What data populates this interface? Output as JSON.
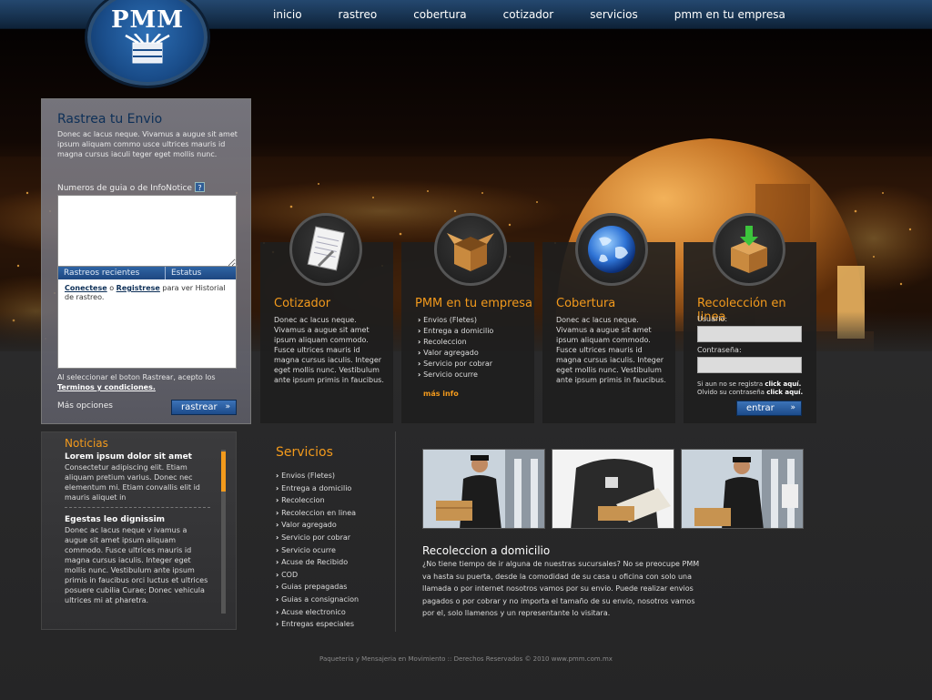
{
  "brand": {
    "logo_text": "PMM"
  },
  "nav": {
    "items": [
      "inicio",
      "rastreo",
      "cobertura",
      "cotizador",
      "servicios",
      "pmm en tu empresa"
    ]
  },
  "tracking": {
    "title": "Rastrea tu Envio",
    "description": "Donec ac lacus neque. Vivamus a augue sit amet ipsum aliquam commo usce ultrices mauris id magna cursus iaculi teger eget mollis nunc.",
    "guide_label": "Numeros de guia o de InfoNotice",
    "guide_help": "?",
    "recent_col1": "Rastreos recientes",
    "recent_col2": "Estatus",
    "recent_link1": "Conectese",
    "recent_conj": " o ",
    "recent_link2": "Registrese",
    "recent_rest": " para ver Historial de rastreo.",
    "select_note": "Al seleccionar el boton Rastrear, acepto los ",
    "terms_link": "Terminos y condiciones.",
    "more_options": "Más opciones",
    "button": "rastrear",
    "button_arrow": "»"
  },
  "news": {
    "title": "Noticias",
    "items": [
      {
        "head": "Lorem ipsum dolor sit amet",
        "body": "Consectetur adipiscing elit. Etiam aliquam pretium varius. Donec nec elementum mi. Etiam convallis elit id mauris aliquet in"
      },
      {
        "head": "Egestas leo dignissim",
        "body": "Donec ac lacus neque v ivamus a augue sit amet ipsum aliquam commodo. Fusce ultrices mauris id magna cursus iaculis. Integer eget mollis nunc. Vestibulum ante ipsum primis in faucibus orci luctus et ultrices posuere cubilia Curae; Donec vehicula ultrices mi at pharetra."
      }
    ]
  },
  "cards": {
    "cotizador": {
      "title": "Cotizador",
      "text": "Donec ac lacus neque. Vivamus a augue sit amet ipsum aliquam commodo. Fusce ultrices mauris id magna cursus iaculis. Integer eget mollis nunc. Vestibulum ante ipsum primis in faucibus."
    },
    "empresa": {
      "title": "PMM en tu empresa",
      "items": [
        "Envios (Fletes)",
        "Entrega a domicilio",
        "Recoleccion",
        "Valor agregado",
        "Servicio por cobrar",
        "Servicio ocurre"
      ],
      "more": "más info"
    },
    "cobertura": {
      "title": "Cobertura",
      "text": "Donec ac lacus neque. Vivamus a augue sit amet ipsum aliquam commodo. Fusce ultrices mauris id magna cursus iaculis. Integer eget mollis nunc. Vestibulum ante ipsum primis in faucibus."
    },
    "recoleccion": {
      "title": "Recolección en linea",
      "user_label": "Usuario:",
      "pass_label": "Contraseña:",
      "note_register": "Si aun no se registra ",
      "note_click1": "click aquí.",
      "note_forgot": "Olvido su contraseña ",
      "note_click2": "click aquí.",
      "button": "entrar",
      "button_arrow": "»"
    }
  },
  "services": {
    "title": "Servicios",
    "items": [
      "Envios (Fletes)",
      "Entrega a domicilio",
      "Recoleccion",
      "Recoleccion en linea",
      "Valor agregado",
      "Servicio por cobrar",
      "Servicio ocurre",
      "Acuse de Recibido",
      "COD",
      "Guias prepagadas",
      "Guias a consignacion",
      "Acuse electronico",
      "Entregas especiales"
    ]
  },
  "home": {
    "title": "Recoleccion a domicilio",
    "text": "¿No tiene tiempo de ir alguna de nuestras sucursales? No se preocupe PMM va hasta su puerta, desde la comodidad de su casa u oficina con solo una llamada o por internet nosotros vamos por su envio. Puede realizar envios pagados o por cobrar y no importa el tamaño de su envio, nosotros vamos por el, solo llamenos y un representante lo visitara."
  },
  "footer": {
    "text": "Paqueteria y Mensajeria en Movimiento :: Derechos Reservados © 2010 www.pmm.com.mx"
  },
  "colors": {
    "accent": "#f39a1c",
    "nav_blue": "#17324f",
    "title_blue": "#0d2f57"
  }
}
